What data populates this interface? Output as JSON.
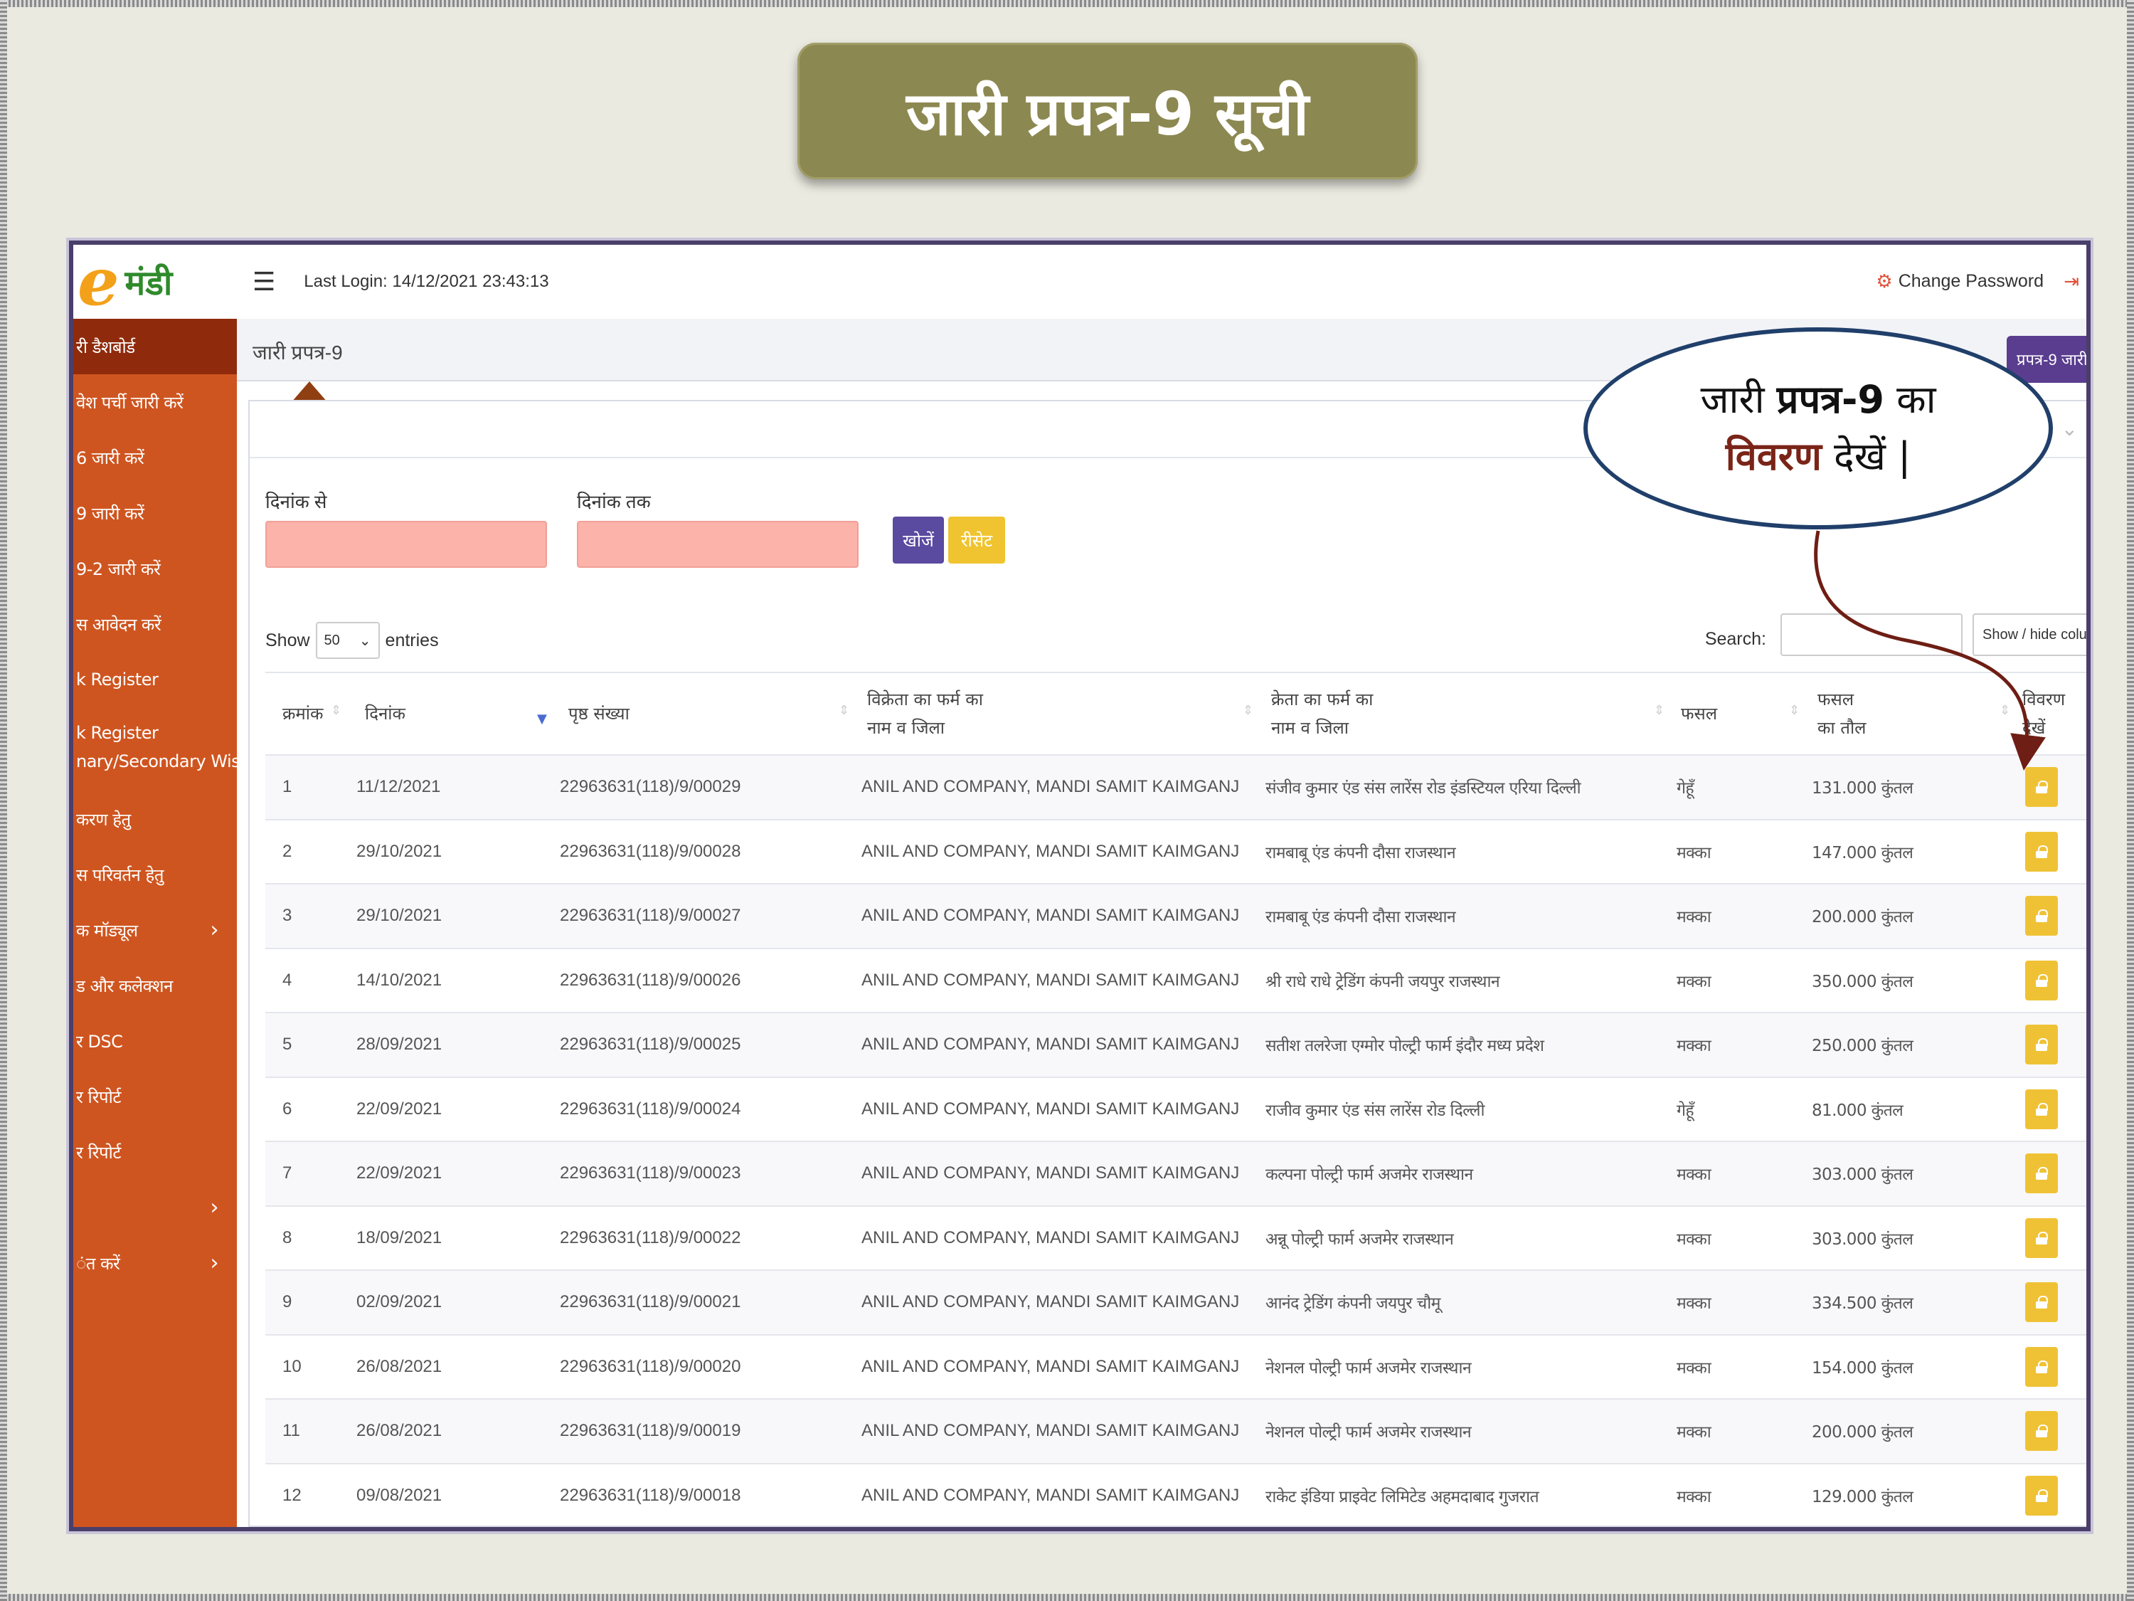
{
  "slide": {
    "title": "जारी प्रपत्र-9 सूची",
    "callout_part1": "जारी ",
    "callout_bold": "प्रपत्र-9",
    "callout_part2": " का",
    "callout_maroon": "विवरण",
    "callout_part3": " देखें |"
  },
  "app": {
    "logo_e": "e",
    "logo_text": "मंडी",
    "last_login": "Last Login: 14/12/2021 23:43:13",
    "change_password": "Change Password",
    "breadcrumb": "जारी प्रपत्र-9",
    "issue_button": "प्रपत्र-9 जारी"
  },
  "sidebar": {
    "items": [
      {
        "label": "री डैशबोर्ड",
        "active": true
      },
      {
        "label": "वेश पर्ची जारी करें"
      },
      {
        "label": "6 जारी करें"
      },
      {
        "label": "9 जारी करें"
      },
      {
        "label": "9-2 जारी करें"
      },
      {
        "label": "स आवेदन करें"
      },
      {
        "label": "k Register"
      },
      {
        "label": "k Register",
        "label2": "nary/Secondary Wise)"
      },
      {
        "label": "करण हेतु"
      },
      {
        "label": "स परिवर्तन हेतु"
      },
      {
        "label": "क मॉड्यूल",
        "chevron": "›"
      },
      {
        "label": "ड और कलेक्शन"
      },
      {
        "label": "र DSC"
      },
      {
        "label": "र रिपोर्ट"
      },
      {
        "label": "र रिपोर्ट"
      },
      {
        "label": "",
        "chevron": "›"
      },
      {
        "label": "ंत करें",
        "chevron": "›"
      }
    ]
  },
  "filters": {
    "from_label": "दिनांक से",
    "to_label": "दिनांक तक",
    "search_button": "खोजें",
    "reset_button": "रीसेट"
  },
  "table_controls": {
    "show": "Show",
    "page_size": "50",
    "entries": "entries",
    "search_label": "Search:",
    "show_hide": "Show / hide colum"
  },
  "table": {
    "headers": {
      "serial": "क्रमांक",
      "date": "दिनांक",
      "page_no": "पृष्ठ संख्या",
      "seller_1": "विक्रेता का फर्म का",
      "seller_2": "नाम व जिला",
      "buyer_1": "क्रेता का फर्म का",
      "buyer_2": "नाम व जिला",
      "crop": "फसल",
      "weight_1": "फसल",
      "weight_2": "का तौल",
      "view_1": "विवरण",
      "view_2": "देखें"
    },
    "rows": [
      {
        "n": "1",
        "date": "11/12/2021",
        "page": "22963631(118)/9/00029",
        "seller": "ANIL AND COMPANY, MANDI SAMIT KAIMGANJ",
        "buyer": "संजीव कुमार एंड संस लारेंस रोड इंडस्टियल एरिया दिल्ली",
        "crop": "गेहूँ",
        "weight": "131.000 कुंतल"
      },
      {
        "n": "2",
        "date": "29/10/2021",
        "page": "22963631(118)/9/00028",
        "seller": "ANIL AND COMPANY, MANDI SAMIT KAIMGANJ",
        "buyer": "रामबाबू एंड कंपनी दौसा राजस्थान",
        "crop": "मक्का",
        "weight": "147.000 कुंतल"
      },
      {
        "n": "3",
        "date": "29/10/2021",
        "page": "22963631(118)/9/00027",
        "seller": "ANIL AND COMPANY, MANDI SAMIT KAIMGANJ",
        "buyer": "रामबाबू एंड कंपनी दौसा राजस्थान",
        "crop": "मक्का",
        "weight": "200.000 कुंतल"
      },
      {
        "n": "4",
        "date": "14/10/2021",
        "page": "22963631(118)/9/00026",
        "seller": "ANIL AND COMPANY, MANDI SAMIT KAIMGANJ",
        "buyer": "श्री राधे राधे ट्रेडिंग कंपनी जयपुर राजस्थान",
        "crop": "मक्का",
        "weight": "350.000 कुंतल"
      },
      {
        "n": "5",
        "date": "28/09/2021",
        "page": "22963631(118)/9/00025",
        "seller": "ANIL AND COMPANY, MANDI SAMIT KAIMGANJ",
        "buyer": "सतीश तलरेजा एग्मोर पोल्ट्री फार्म इंदौर मध्य प्रदेश",
        "crop": "मक्का",
        "weight": "250.000 कुंतल"
      },
      {
        "n": "6",
        "date": "22/09/2021",
        "page": "22963631(118)/9/00024",
        "seller": "ANIL AND COMPANY, MANDI SAMIT KAIMGANJ",
        "buyer": "राजीव कुमार एंड संस लारेंस रोड दिल्ली",
        "crop": "गेहूँ",
        "weight": "81.000 कुंतल"
      },
      {
        "n": "7",
        "date": "22/09/2021",
        "page": "22963631(118)/9/00023",
        "seller": "ANIL AND COMPANY, MANDI SAMIT KAIMGANJ",
        "buyer": "कल्पना पोल्ट्री फार्म अजमेर राजस्थान",
        "crop": "मक्का",
        "weight": "303.000 कुंतल"
      },
      {
        "n": "8",
        "date": "18/09/2021",
        "page": "22963631(118)/9/00022",
        "seller": "ANIL AND COMPANY, MANDI SAMIT KAIMGANJ",
        "buyer": "अन्नू पोल्ट्री फार्म अजमेर राजस्थान",
        "crop": "मक्का",
        "weight": "303.000 कुंतल"
      },
      {
        "n": "9",
        "date": "02/09/2021",
        "page": "22963631(118)/9/00021",
        "seller": "ANIL AND COMPANY, MANDI SAMIT KAIMGANJ",
        "buyer": "आनंद ट्रेडिंग कंपनी जयपुर चौमू",
        "crop": "मक्का",
        "weight": "334.500 कुंतल"
      },
      {
        "n": "10",
        "date": "26/08/2021",
        "page": "22963631(118)/9/00020",
        "seller": "ANIL AND COMPANY, MANDI SAMIT KAIMGANJ",
        "buyer": "नेशनल पोल्ट्री फार्म अजमेर राजस्थान",
        "crop": "मक्का",
        "weight": "154.000 कुंतल"
      },
      {
        "n": "11",
        "date": "26/08/2021",
        "page": "22963631(118)/9/00019",
        "seller": "ANIL AND COMPANY, MANDI SAMIT KAIMGANJ",
        "buyer": "नेशनल पोल्ट्री फार्म अजमेर राजस्थान",
        "crop": "मक्का",
        "weight": "200.000 कुंतल"
      },
      {
        "n": "12",
        "date": "09/08/2021",
        "page": "22963631(118)/9/00018",
        "seller": "ANIL AND COMPANY, MANDI SAMIT KAIMGANJ",
        "buyer": "राकेट इंडिया प्राइवेट लिमिटेड अहमदाबाद गुजरात",
        "crop": "मक्का",
        "weight": "129.000 कुंतल"
      }
    ]
  },
  "colors": {
    "sidebar": "#cf5520",
    "sidebar_active": "#8f2b0c",
    "title_banner": "#8c8851",
    "view_button": "#efc236",
    "callout_border": "#203f6a"
  }
}
